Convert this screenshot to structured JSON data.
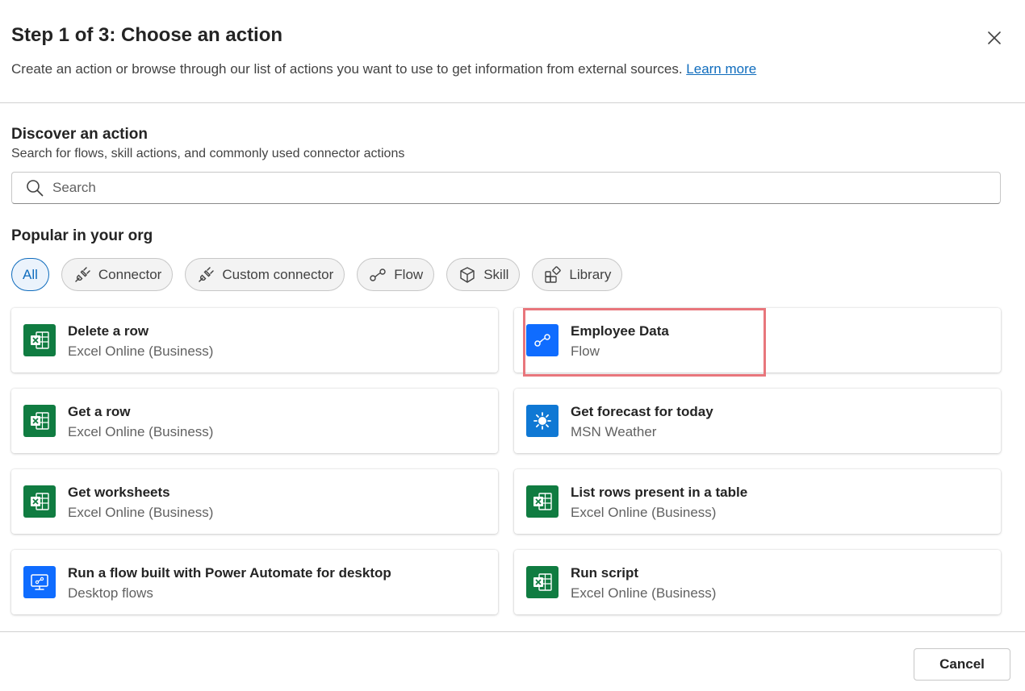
{
  "header": {
    "title": "Step 1 of 3: Choose an action",
    "subtitle": "Create an action or browse through our list of actions you want to use to get information from external sources.",
    "learn_more": "Learn more",
    "close_icon": "close-icon"
  },
  "discover": {
    "title": "Discover an action",
    "subtitle": "Search for flows, skill actions, and commonly used connector actions",
    "search_placeholder": "Search"
  },
  "popular": {
    "title": "Popular in your org",
    "filters": [
      {
        "label": "All",
        "icon": "",
        "selected": true
      },
      {
        "label": "Connector",
        "icon": "plug-icon"
      },
      {
        "label": "Custom connector",
        "icon": "plug-icon"
      },
      {
        "label": "Flow",
        "icon": "flow-icon"
      },
      {
        "label": "Skill",
        "icon": "cube-icon"
      },
      {
        "label": "Library",
        "icon": "apps-add-icon"
      }
    ]
  },
  "actions": [
    {
      "name": "Delete a row",
      "source": "Excel Online (Business)",
      "icon": "excel-icon"
    },
    {
      "name": "Employee Data",
      "source": "Flow",
      "icon": "flow-icon",
      "highlighted": true
    },
    {
      "name": "Get a row",
      "source": "Excel Online (Business)",
      "icon": "excel-icon"
    },
    {
      "name": "Get forecast for today",
      "source": "MSN Weather",
      "icon": "sun-icon"
    },
    {
      "name": "Get worksheets",
      "source": "Excel Online (Business)",
      "icon": "excel-icon"
    },
    {
      "name": "List rows present in a table",
      "source": "Excel Online (Business)",
      "icon": "excel-icon"
    },
    {
      "name": "Run a flow built with Power Automate for desktop",
      "source": "Desktop flows",
      "icon": "desktop-flow-icon"
    },
    {
      "name": "Run script",
      "source": "Excel Online (Business)",
      "icon": "excel-icon"
    }
  ],
  "footer": {
    "cancel_label": "Cancel"
  },
  "colors": {
    "accent": "#0f6cbd",
    "excel": "#107c41",
    "flow": "#0f6cff",
    "highlight": "#e8767c"
  }
}
